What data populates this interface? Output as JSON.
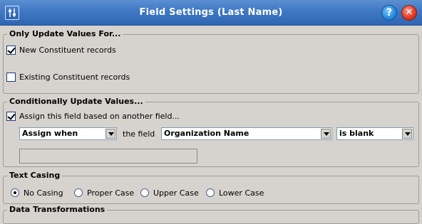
{
  "window": {
    "title": "Field Settings (Last Name)",
    "help_label": "?",
    "close_label": "✕"
  },
  "only_update": {
    "legend": "Only Update Values For...",
    "new_records": {
      "label": "New Constituent records",
      "checked": true
    },
    "existing_records": {
      "label": "Existing Constituent records",
      "checked": false
    }
  },
  "conditional": {
    "legend": "Conditionally Update Values...",
    "assign_check": {
      "label": "Assign this field based on another field...",
      "checked": true
    },
    "assign_when": "Assign when",
    "the_field_label": "the field",
    "field_select": "Organization Name",
    "condition_select": "is blank",
    "value_input": ""
  },
  "text_casing": {
    "legend": "Text Casing",
    "options": [
      "No Casing",
      "Proper Case",
      "Upper Case",
      "Lower Case"
    ],
    "selected": "No Casing"
  },
  "next_section": {
    "legend": "Data Transformations"
  }
}
